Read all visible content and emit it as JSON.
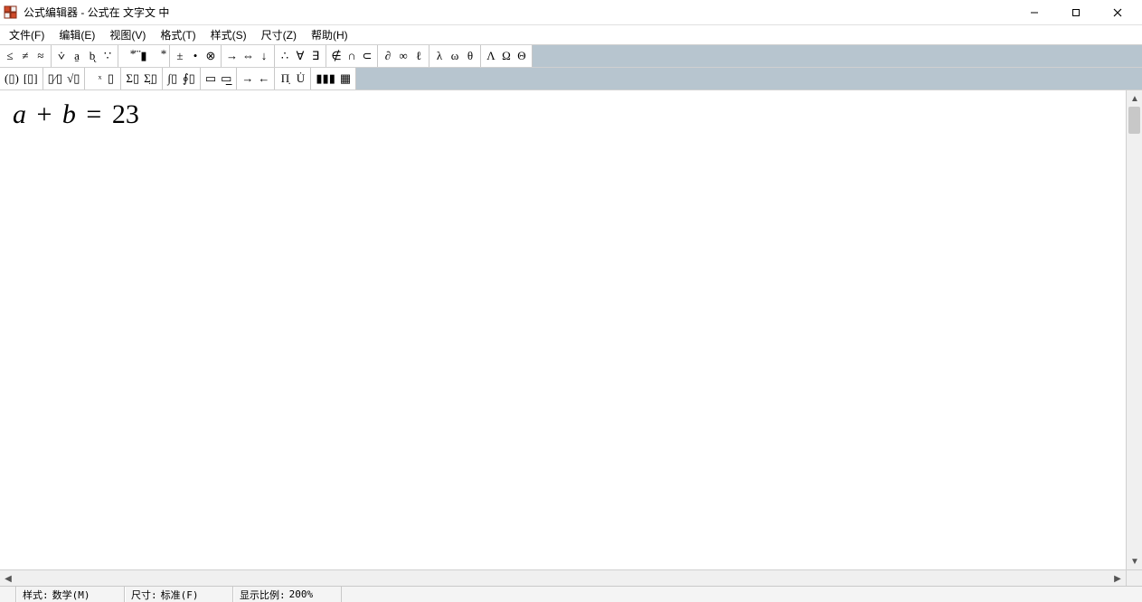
{
  "titlebar": {
    "title": "公式编辑器 - 公式在 文字文 中"
  },
  "menu": {
    "file": "文件(F)",
    "edit": "编辑(E)",
    "view": "视图(V)",
    "format": "格式(T)",
    "style": "样式(S)",
    "size": "尺寸(Z)",
    "help": "帮助(H)"
  },
  "toolbar_row1": {
    "g1": {
      "a": "≤",
      "b": "≠",
      "c": "≈"
    },
    "g2": {
      "a": "⩒",
      "b": "a̱",
      "c": "b̨",
      "d": "∵"
    },
    "g3": {
      "a": "▮⃰",
      "b": "⃛▮",
      "c": "▮⃰"
    },
    "g4": {
      "a": "±",
      "b": "•",
      "c": "⊗"
    },
    "g5": {
      "a": "→",
      "b": "⇔",
      "c": "↓"
    },
    "g6": {
      "a": "∴",
      "b": "∀",
      "c": "∃"
    },
    "g7": {
      "a": "∉",
      "b": "∩",
      "c": "⊂"
    },
    "g8": {
      "a": "∂",
      "b": "∞",
      "c": "ℓ"
    },
    "g9": {
      "a": "λ",
      "b": "ω",
      "c": "θ"
    },
    "g10": {
      "a": "Λ",
      "b": "Ω",
      "c": "Θ"
    }
  },
  "toolbar_row2": {
    "g1": {
      "a": "(▯)",
      "b": "[▯]"
    },
    "g2": {
      "a": "▯⁄▯",
      "b": "√▯"
    },
    "g3": {
      "a": "▯ͯ",
      "b": "▯"
    },
    "g4": {
      "a": "Σ▯",
      "b": "Σ̤▯"
    },
    "g5": {
      "a": "∫▯",
      "b": "∮▯"
    },
    "g6": {
      "a": "▭",
      "b": "▭̲"
    },
    "g7": {
      "a": "→",
      "b": "←"
    },
    "g8": {
      "a": "Π̣",
      "b": "U̇"
    },
    "g9": {
      "a": "▮▮▮",
      "b": "▦"
    }
  },
  "equation": {
    "var_a": "a",
    "plus": "+",
    "var_b": "b",
    "eq": "=",
    "rhs": "23"
  },
  "statusbar": {
    "style_label": "样式:",
    "style_value": "数学(M)",
    "size_label": "尺寸:",
    "size_value": "标准(F)",
    "zoom_label": "显示比例:",
    "zoom_value": "200%"
  }
}
